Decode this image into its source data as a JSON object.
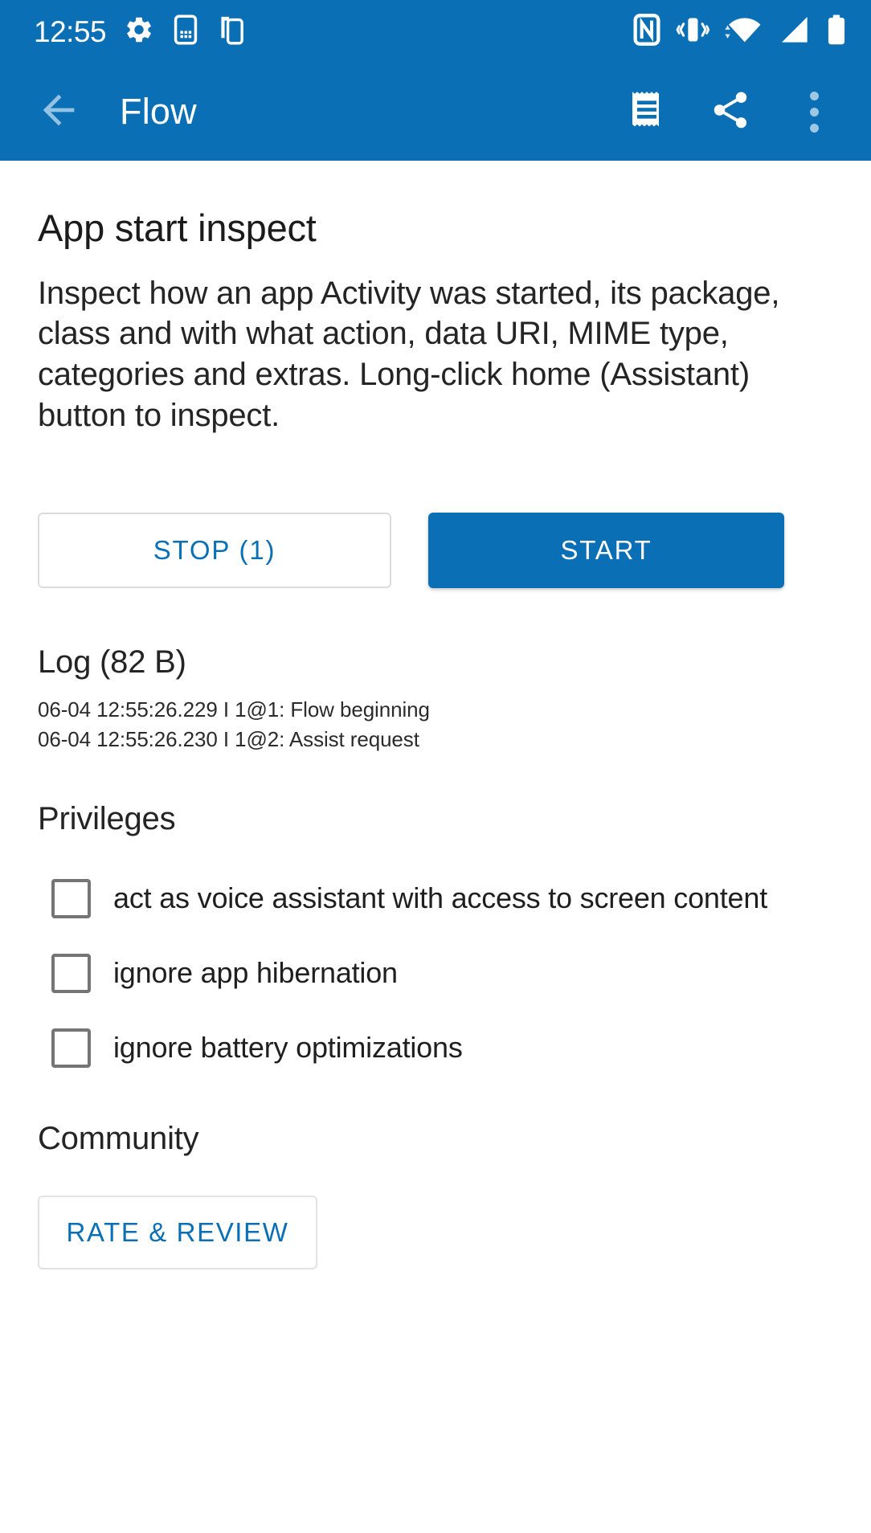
{
  "theme": {
    "primary": "#0A6FB5",
    "on_primary": "#FFFFFF",
    "accent_text": "#0A6FB5",
    "body_text": "#242424",
    "checkbox_border": "#757575",
    "outline": "#DCDCDC"
  },
  "status_bar": {
    "clock": "12:55",
    "left_icons": [
      "gear-icon",
      "sim-card-icon",
      "multi-window-icon"
    ],
    "right_icons": [
      "nfc-icon",
      "vibrate-icon",
      "wifi-icon",
      "cellular-signal-icon",
      "battery-icon"
    ]
  },
  "app_bar": {
    "back_label": "back-arrow",
    "title": "Flow",
    "actions": [
      "log-receipt-icon",
      "share-icon",
      "overflow-menu-icon"
    ]
  },
  "main": {
    "heading": "App start inspect",
    "description": "Inspect how an app Activity was started, its package, class and with what action, data URI, MIME type, categories and extras. Long-click home (Assistant) button to inspect.",
    "buttons": {
      "stop_label": "STOP (1)",
      "start_label": "START"
    },
    "log": {
      "title": "Log (82 B)",
      "entries": [
        "06-04 12:55:26.229 I 1@1: Flow beginning",
        "06-04 12:55:26.230 I 1@2: Assist request"
      ]
    },
    "privileges": {
      "title": "Privileges",
      "items": [
        {
          "label": "act as voice assistant with access to screen content",
          "checked": false
        },
        {
          "label": "ignore app hibernation",
          "checked": false
        },
        {
          "label": "ignore battery optimizations",
          "checked": false
        }
      ]
    },
    "community": {
      "title": "Community",
      "rate_label": "RATE & REVIEW"
    }
  }
}
